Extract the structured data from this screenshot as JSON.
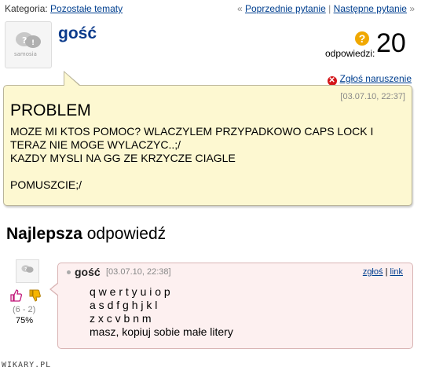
{
  "breadcrumb": {
    "label": "Kategoria:",
    "category": "Pozostałe tematy"
  },
  "nav": {
    "prefix": "«",
    "prev": "Poprzednie pytanie",
    "sep": "|",
    "next": "Następne pytanie",
    "suffix": "»"
  },
  "question": {
    "author": "gość",
    "answers_label": "odpowiedzi:",
    "answers_count": "20",
    "report": "Zgłoś naruszenie",
    "date": "[03.07.10, 22:37]",
    "title": "PROBLEM",
    "body": "MOZE MI KTOS POMOC? WLACZYLEM PRZYPADKOWO CAPS LOCK I\nTERAZ NIE MOGE WYLACZYC..;/\nKAZDY MYSLI NA GG ZE KRZYCZE CIAGLE\n\nPOMUSZCIE;/"
  },
  "best": {
    "bold": "Najlepsza",
    "rest": " odpowiedź"
  },
  "answer": {
    "author": "gość",
    "date": "[03.07.10, 22:38]",
    "report_link": "zgłoś",
    "link": "link",
    "votes": "(6 - 2)",
    "percent": "75%",
    "body": "q w e r t y u i o p\na s d f g h j k l\nz x c v b n m\nmasz, kopiuj sobie małe litery"
  },
  "watermark": "WIKARY.PL",
  "colors": {
    "author": "#0b3b8c",
    "question_bg": "#fdf8d1",
    "answer_bg": "#fdf0f0",
    "report_icon": "#d4161a",
    "qmark_icon": "#f0a800"
  }
}
